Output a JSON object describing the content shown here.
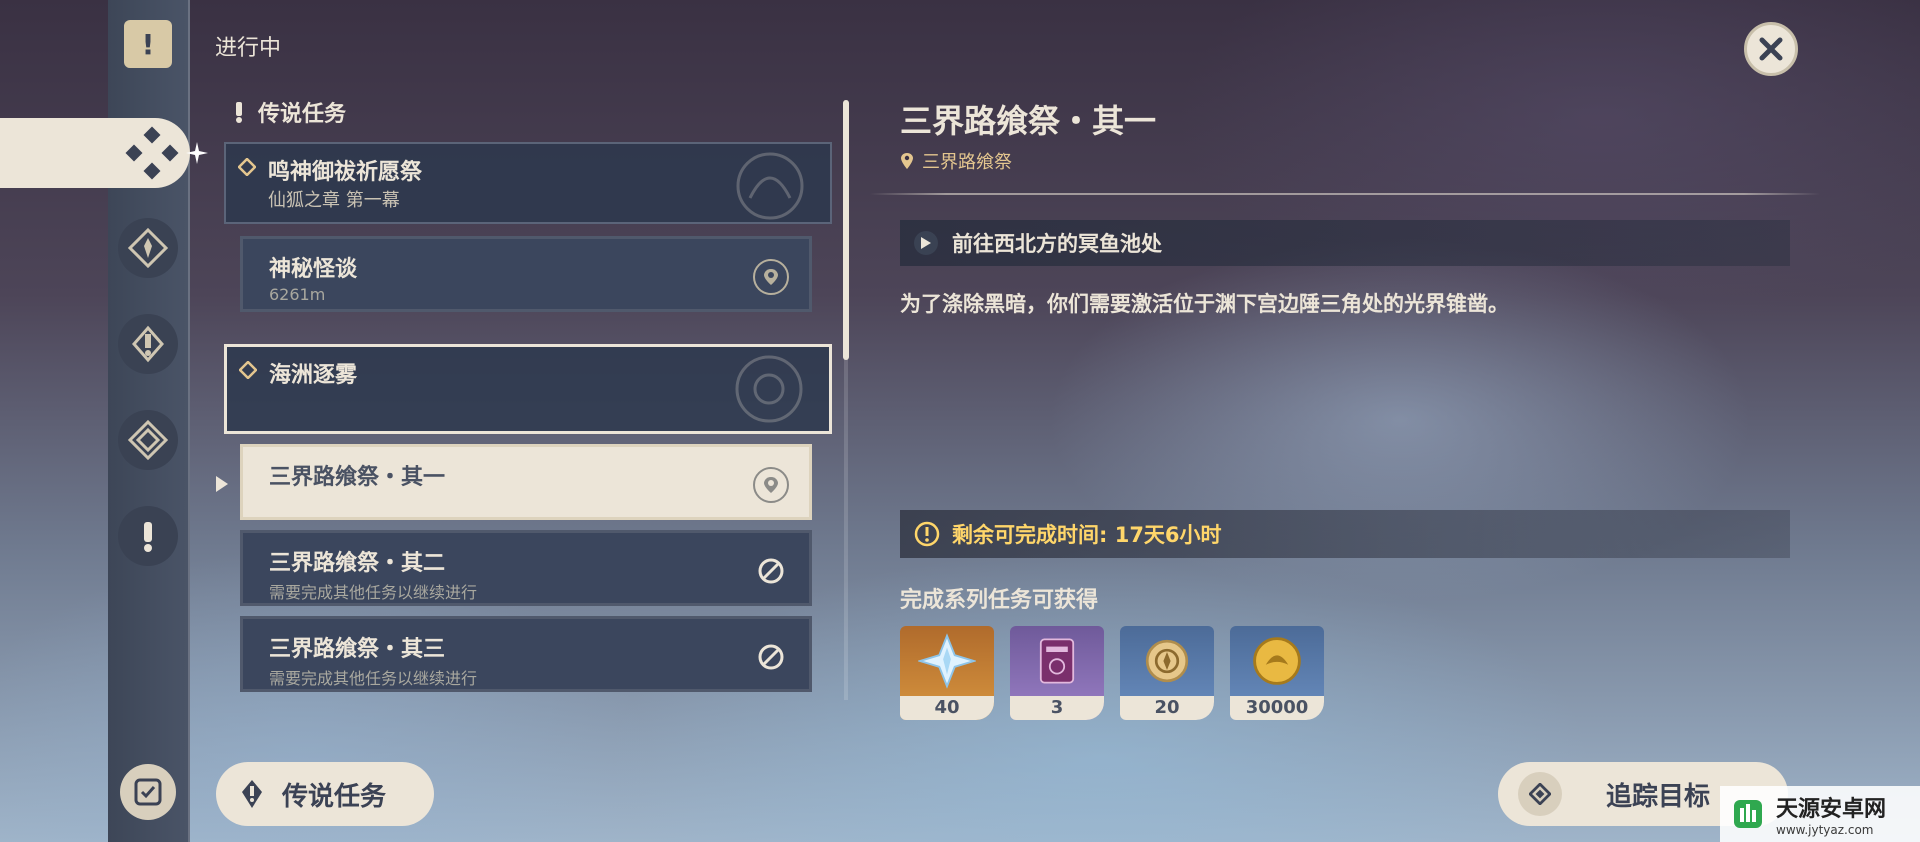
{
  "section_title": "进行中",
  "category_label": "传说任务",
  "groups": [
    {
      "title": "鸣神御祓祈愿祭",
      "subtitle": "仙狐之章 第一幕"
    },
    {
      "title": "海洲逐雾",
      "subtitle": ""
    }
  ],
  "quests": [
    {
      "title": "神秘怪谈",
      "sub": "6261m",
      "icon": "map-pin-icon",
      "state": "normal"
    },
    {
      "title": "三界路飨祭・其一",
      "sub": "",
      "icon": "map-pin-icon",
      "state": "active"
    },
    {
      "title": "三界路飨祭・其二",
      "sub": "需要完成其他任务以继续进行",
      "icon": "blocked-icon",
      "state": "locked"
    },
    {
      "title": "三界路飨祭・其三",
      "sub": "需要完成其他任务以继续进行",
      "icon": "blocked-icon",
      "state": "locked"
    }
  ],
  "bottom_left_button": "传说任务",
  "detail": {
    "title": "三界路飨祭・其一",
    "location": "三界路飨祭",
    "objective": "前往西北方的冥鱼池处",
    "description": "为了涤除黑暗，你们需要激活位于渊下宫边陲三角处的光界锥凿。",
    "time_remaining": "剩余可完成时间: 17天6小时",
    "rewards_label": "完成系列任务可获得",
    "rewards": [
      {
        "icon": "primogem-icon",
        "count": "40"
      },
      {
        "icon": "heros-wit-book-icon",
        "count": "3"
      },
      {
        "icon": "exp-medal-icon",
        "count": "20"
      },
      {
        "icon": "mora-coin-icon",
        "count": "30000"
      }
    ],
    "track_button": "追踪目标"
  },
  "watermark": {
    "title": "天源安卓网",
    "url": "www.jytyaz.com"
  },
  "colors": {
    "accent_cream": "#ece5d8",
    "card_dark": "#3b465d",
    "gold": "#e4c68f",
    "timer": "#ffd66a"
  }
}
